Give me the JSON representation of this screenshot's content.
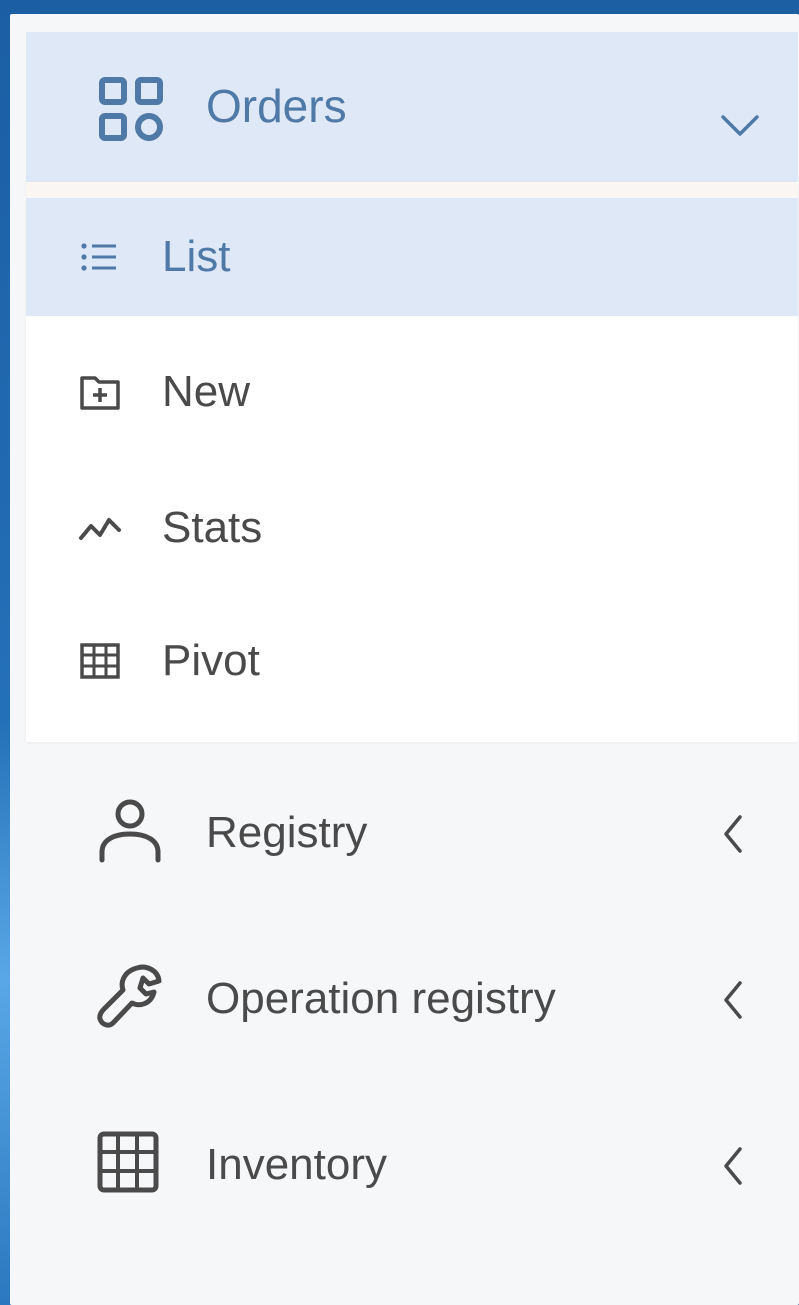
{
  "nav": {
    "orders": {
      "label": "Orders",
      "icon": "grid-apps-icon",
      "expanded": true,
      "chevron": "chevron-down-icon",
      "accent_color": "#4f79a6",
      "active_bg": "#dfe8f7",
      "children": [
        {
          "label": "List",
          "icon": "list-icon",
          "active": true
        },
        {
          "label": "New",
          "icon": "folder-plus-icon",
          "active": false
        },
        {
          "label": "Stats",
          "icon": "trend-icon",
          "active": false
        },
        {
          "label": "Pivot",
          "icon": "table-icon",
          "active": false
        }
      ]
    },
    "items": [
      {
        "label": "Registry",
        "icon": "user-icon",
        "chevron": "chevron-left-icon"
      },
      {
        "label": "Operation registry",
        "icon": "wrench-icon",
        "chevron": "chevron-left-icon"
      },
      {
        "label": "Inventory",
        "icon": "grid-icon",
        "chevron": "chevron-left-icon"
      }
    ]
  }
}
